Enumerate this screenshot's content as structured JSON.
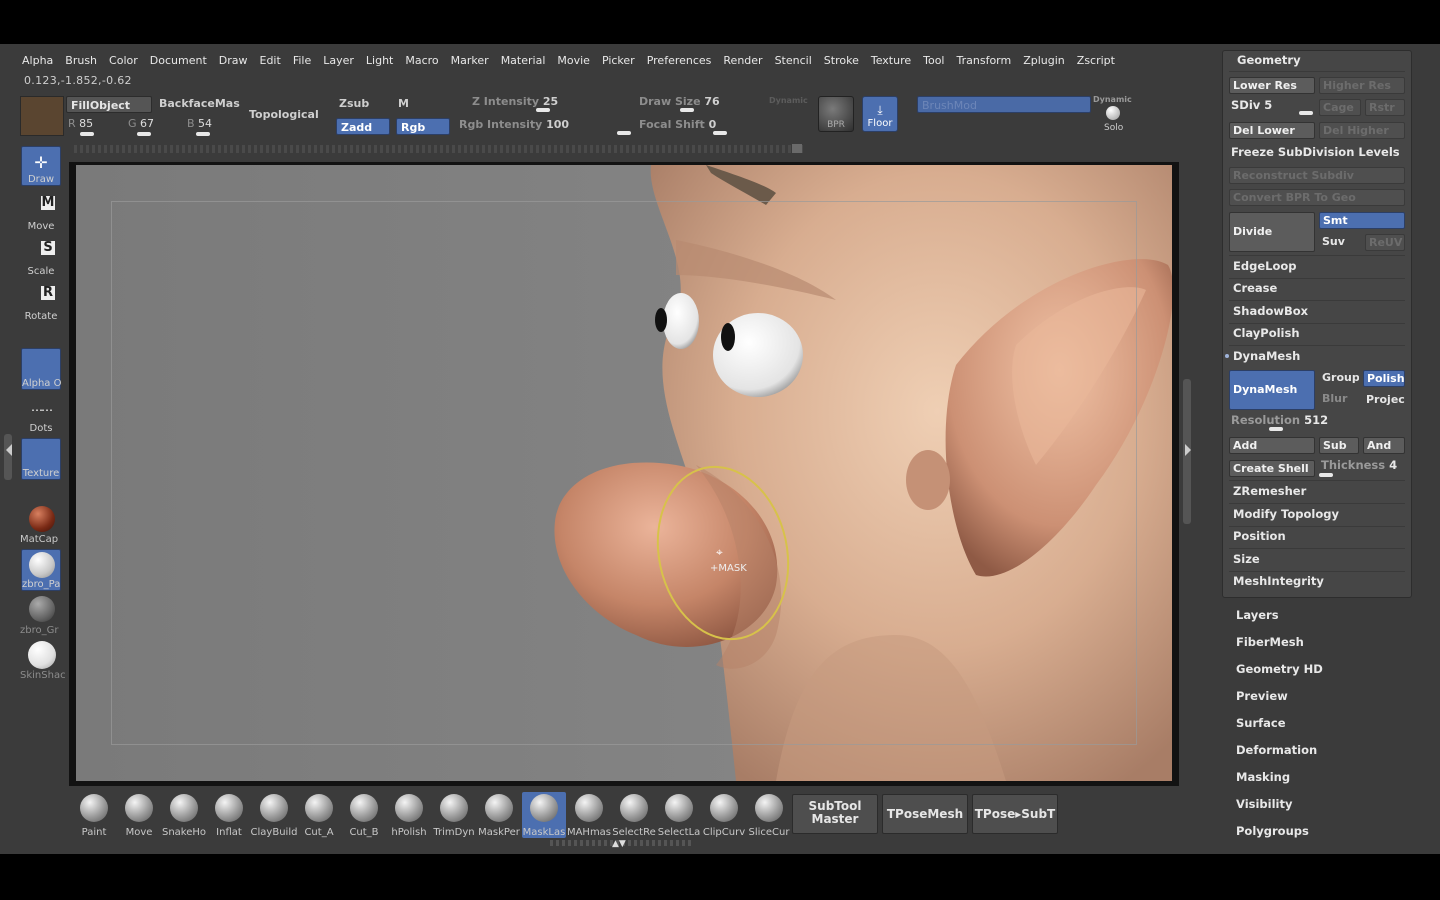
{
  "menu": [
    "Alpha",
    "Brush",
    "Color",
    "Document",
    "Draw",
    "Edit",
    "File",
    "Layer",
    "Light",
    "Macro",
    "Marker",
    "Material",
    "Movie",
    "Picker",
    "Preferences",
    "Render",
    "Stencil",
    "Stroke",
    "Texture",
    "Tool",
    "Transform",
    "Zplugin",
    "Zscript"
  ],
  "coords": "0.123,-1.852,-0.62",
  "toolbar": {
    "fill_object": "FillObject",
    "backface": "BackfaceMas",
    "topological": "Topological",
    "r_label": "R",
    "r_value": "85",
    "g_label": "G",
    "g_value": "67",
    "b_label": "B",
    "b_value": "54",
    "zsub": "Zsub",
    "m": "M",
    "zadd": "Zadd",
    "rgb": "Rgb",
    "z_intensity_label": "Z Intensity",
    "z_intensity_value": "25",
    "rgb_intensity_label": "Rgb Intensity",
    "rgb_intensity_value": "100",
    "draw_size_label": "Draw Size",
    "draw_size_value": "76",
    "dynamic_label": "Dynamic",
    "focal_shift_label": "Focal Shift",
    "focal_shift_value": "0",
    "bpr": "BPR",
    "floor": "Floor",
    "brushmod": "BrushMod",
    "dynamic2": "Dynamic",
    "solo": "Solo"
  },
  "left_shelf": {
    "draw": "Draw",
    "move": "Move",
    "scale": "Scale",
    "rotate": "Rotate",
    "alpha": "Alpha O",
    "dots": "Dots",
    "texture": "Texture",
    "matcap": "MatCap",
    "zbro_pa": "zbro_Pa",
    "zbro_gr": "zbro_Gr",
    "skinshade": "SkinShac"
  },
  "cursor_label": "+MASK",
  "brushes": [
    "Paint",
    "Move",
    "SnakeHo",
    "Inflat",
    "ClayBuild",
    "Cut_A",
    "Cut_B",
    "hPolish",
    "TrimDyn",
    "MaskPer",
    "MaskLas",
    "MAHmas",
    "SelectRe",
    "SelectLa",
    "ClipCurv",
    "SliceCur"
  ],
  "active_brush_index": 10,
  "bottom_buttons": {
    "subtool_master": "SubTool Master",
    "tposemesh": "TPoseMesh",
    "tpose_subt": "TPose▸SubT"
  },
  "geometry_panel": {
    "title": "Geometry",
    "lower_res": "Lower Res",
    "higher_res": "Higher Res",
    "sdiv_label": "SDiv",
    "sdiv_value": "5",
    "cage": "Cage",
    "rstr": "Rstr",
    "del_lower": "Del Lower",
    "del_higher": "Del Higher",
    "freeze": "Freeze SubDivision Levels",
    "reconstruct": "Reconstruct Subdiv",
    "convert_bpr": "Convert BPR To Geo",
    "divide": "Divide",
    "smt": "Smt",
    "suv": "Suv",
    "reuv": "ReUV",
    "edgeloop": "EdgeLoop",
    "crease": "Crease",
    "shadowbox": "ShadowBox",
    "claypolish": "ClayPolish",
    "dynamesh_section": "DynaMesh",
    "dynamesh_btn": "DynaMesh",
    "group": "Group",
    "polish": "Polish",
    "blur": "Blur",
    "project": "Projec",
    "resolution_label": "Resolution",
    "resolution_value": "512",
    "add": "Add",
    "sub": "Sub",
    "and": "And",
    "create_shell": "Create Shell",
    "thickness_label": "Thickness",
    "thickness_value": "4",
    "zremesher": "ZRemesher",
    "modify_topology": "Modify Topology",
    "position": "Position",
    "size": "Size",
    "meshintegrity": "MeshIntegrity"
  },
  "tool_subpalettes": [
    "Layers",
    "FiberMesh",
    "Geometry HD",
    "Preview",
    "Surface",
    "Deformation",
    "Masking",
    "Visibility",
    "Polygroups"
  ]
}
